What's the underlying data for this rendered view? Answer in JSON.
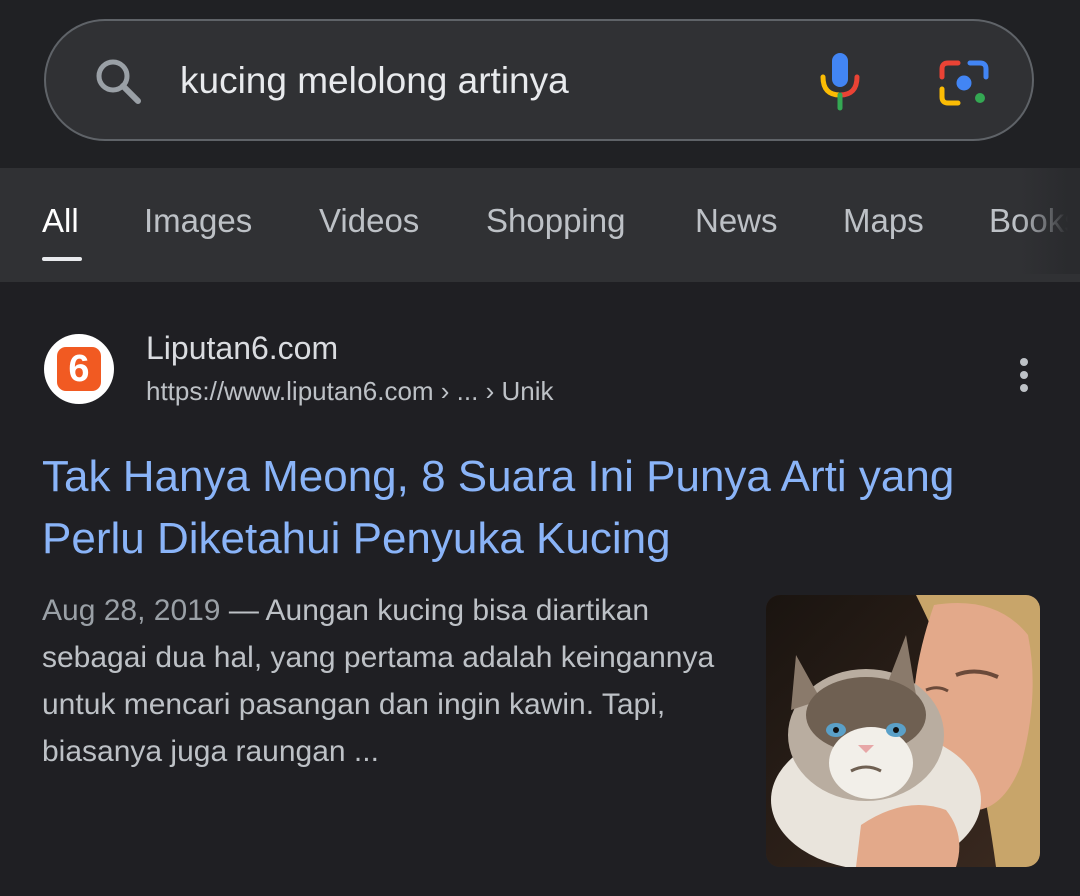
{
  "search": {
    "query": "kucing melolong artinya",
    "search_icon": "search-icon",
    "mic_icon": "microphone-icon",
    "lens_icon": "google-lens-icon"
  },
  "tabs": [
    {
      "label": "All",
      "active": true
    },
    {
      "label": "Images"
    },
    {
      "label": "Videos"
    },
    {
      "label": "Shopping"
    },
    {
      "label": "News"
    },
    {
      "label": "Maps"
    },
    {
      "label": "Books"
    }
  ],
  "result": {
    "favicon_text": "6",
    "favicon_color": "#f15a22",
    "site_name": "Liputan6.com",
    "url": "https://www.liputan6.com › ... › Unik",
    "title": "Tak Hanya Meong, 8 Suara Ini Punya Arti yang Perlu Diketahui Penyuka Kucing",
    "date": "Aug 28, 2019",
    "snippet": " — Aungan kucing bisa diartikan sebagai dua hal, yang pertama adalah keingannya untuk mencari pasangan dan ingin kawin. Tapi, biasanya juga raungan ...",
    "more_icon": "more-vertical-icon",
    "thumbnail": "cat-photo-thumbnail"
  },
  "colors": {
    "background": "#202124",
    "link": "#8ab4f8",
    "tab_bar": "#303134"
  }
}
